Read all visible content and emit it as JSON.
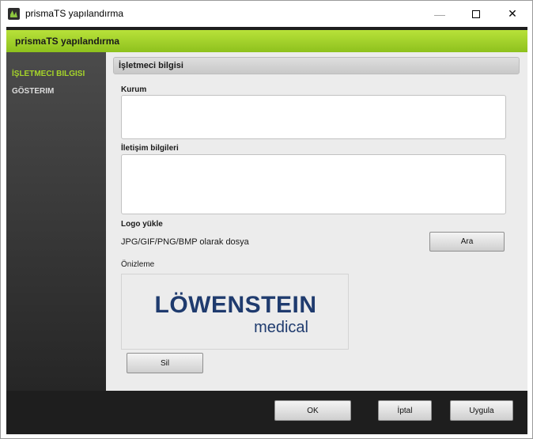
{
  "window": {
    "title": "prismaTS yapılandırma",
    "minimize_glyph": "—",
    "close_glyph": "✕"
  },
  "app": {
    "header_title": "prismaTS yapılandırma"
  },
  "sidebar": {
    "items": [
      {
        "label": "İŞLETMECI BILGISI",
        "active": true
      },
      {
        "label": "GÖSTERIM",
        "active": false
      }
    ]
  },
  "main": {
    "section_title": "İşletmeci bilgisi",
    "organization_label": "Kurum",
    "organization_value": "",
    "contact_label": "İletişim bilgileri",
    "contact_value": "",
    "logo_upload_label": "Logo yükle",
    "file_types_text": "JPG/GIF/PNG/BMP olarak dosya",
    "browse_button": "Ara",
    "preview_label": "Önizleme",
    "logo_text_main": "LÖWENSTEIN",
    "logo_text_sub": "medical",
    "delete_button": "Sil"
  },
  "footer": {
    "ok_button": "OK",
    "cancel_button": "İptal",
    "apply_button": "Uygula"
  },
  "colors": {
    "accent_green": "#a5d42a",
    "header_green": "#8ec11d",
    "logo_blue": "#1f3b6e",
    "dark_frame": "#1e1e1e"
  }
}
